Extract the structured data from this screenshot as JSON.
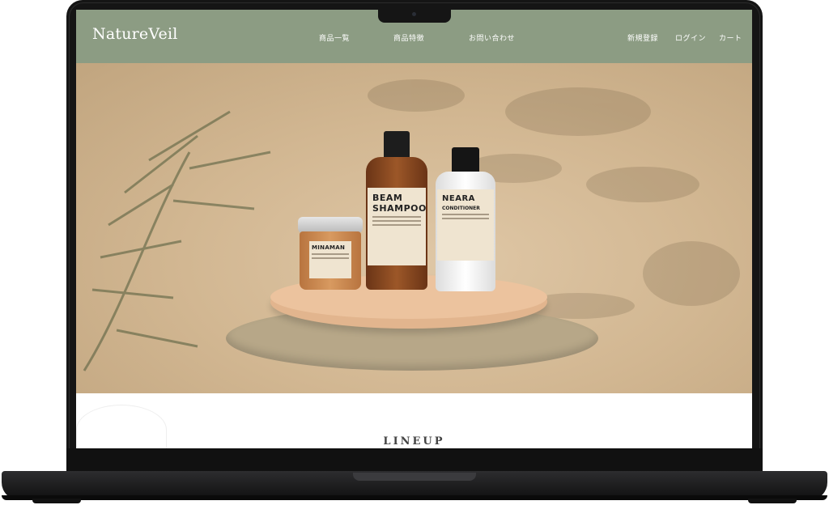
{
  "site": {
    "logo": "NatureVeil"
  },
  "nav": {
    "left": [
      "商品一覧",
      "商品特徴",
      "お問い合わせ"
    ],
    "right": [
      "新規登録",
      "ログイン",
      "カート"
    ]
  },
  "colors": {
    "header_bg": "#8c9c83",
    "hero_bg": "#d2b792"
  },
  "products": {
    "jar": {
      "title": "MINAMAN"
    },
    "shampoo": {
      "title_line1": "BEAM",
      "title_line2": "SHAMPOO"
    },
    "conditioner": {
      "title": "NEARA",
      "subtitle": "CONDITIONER"
    }
  },
  "section": {
    "title": "LINEUP"
  }
}
